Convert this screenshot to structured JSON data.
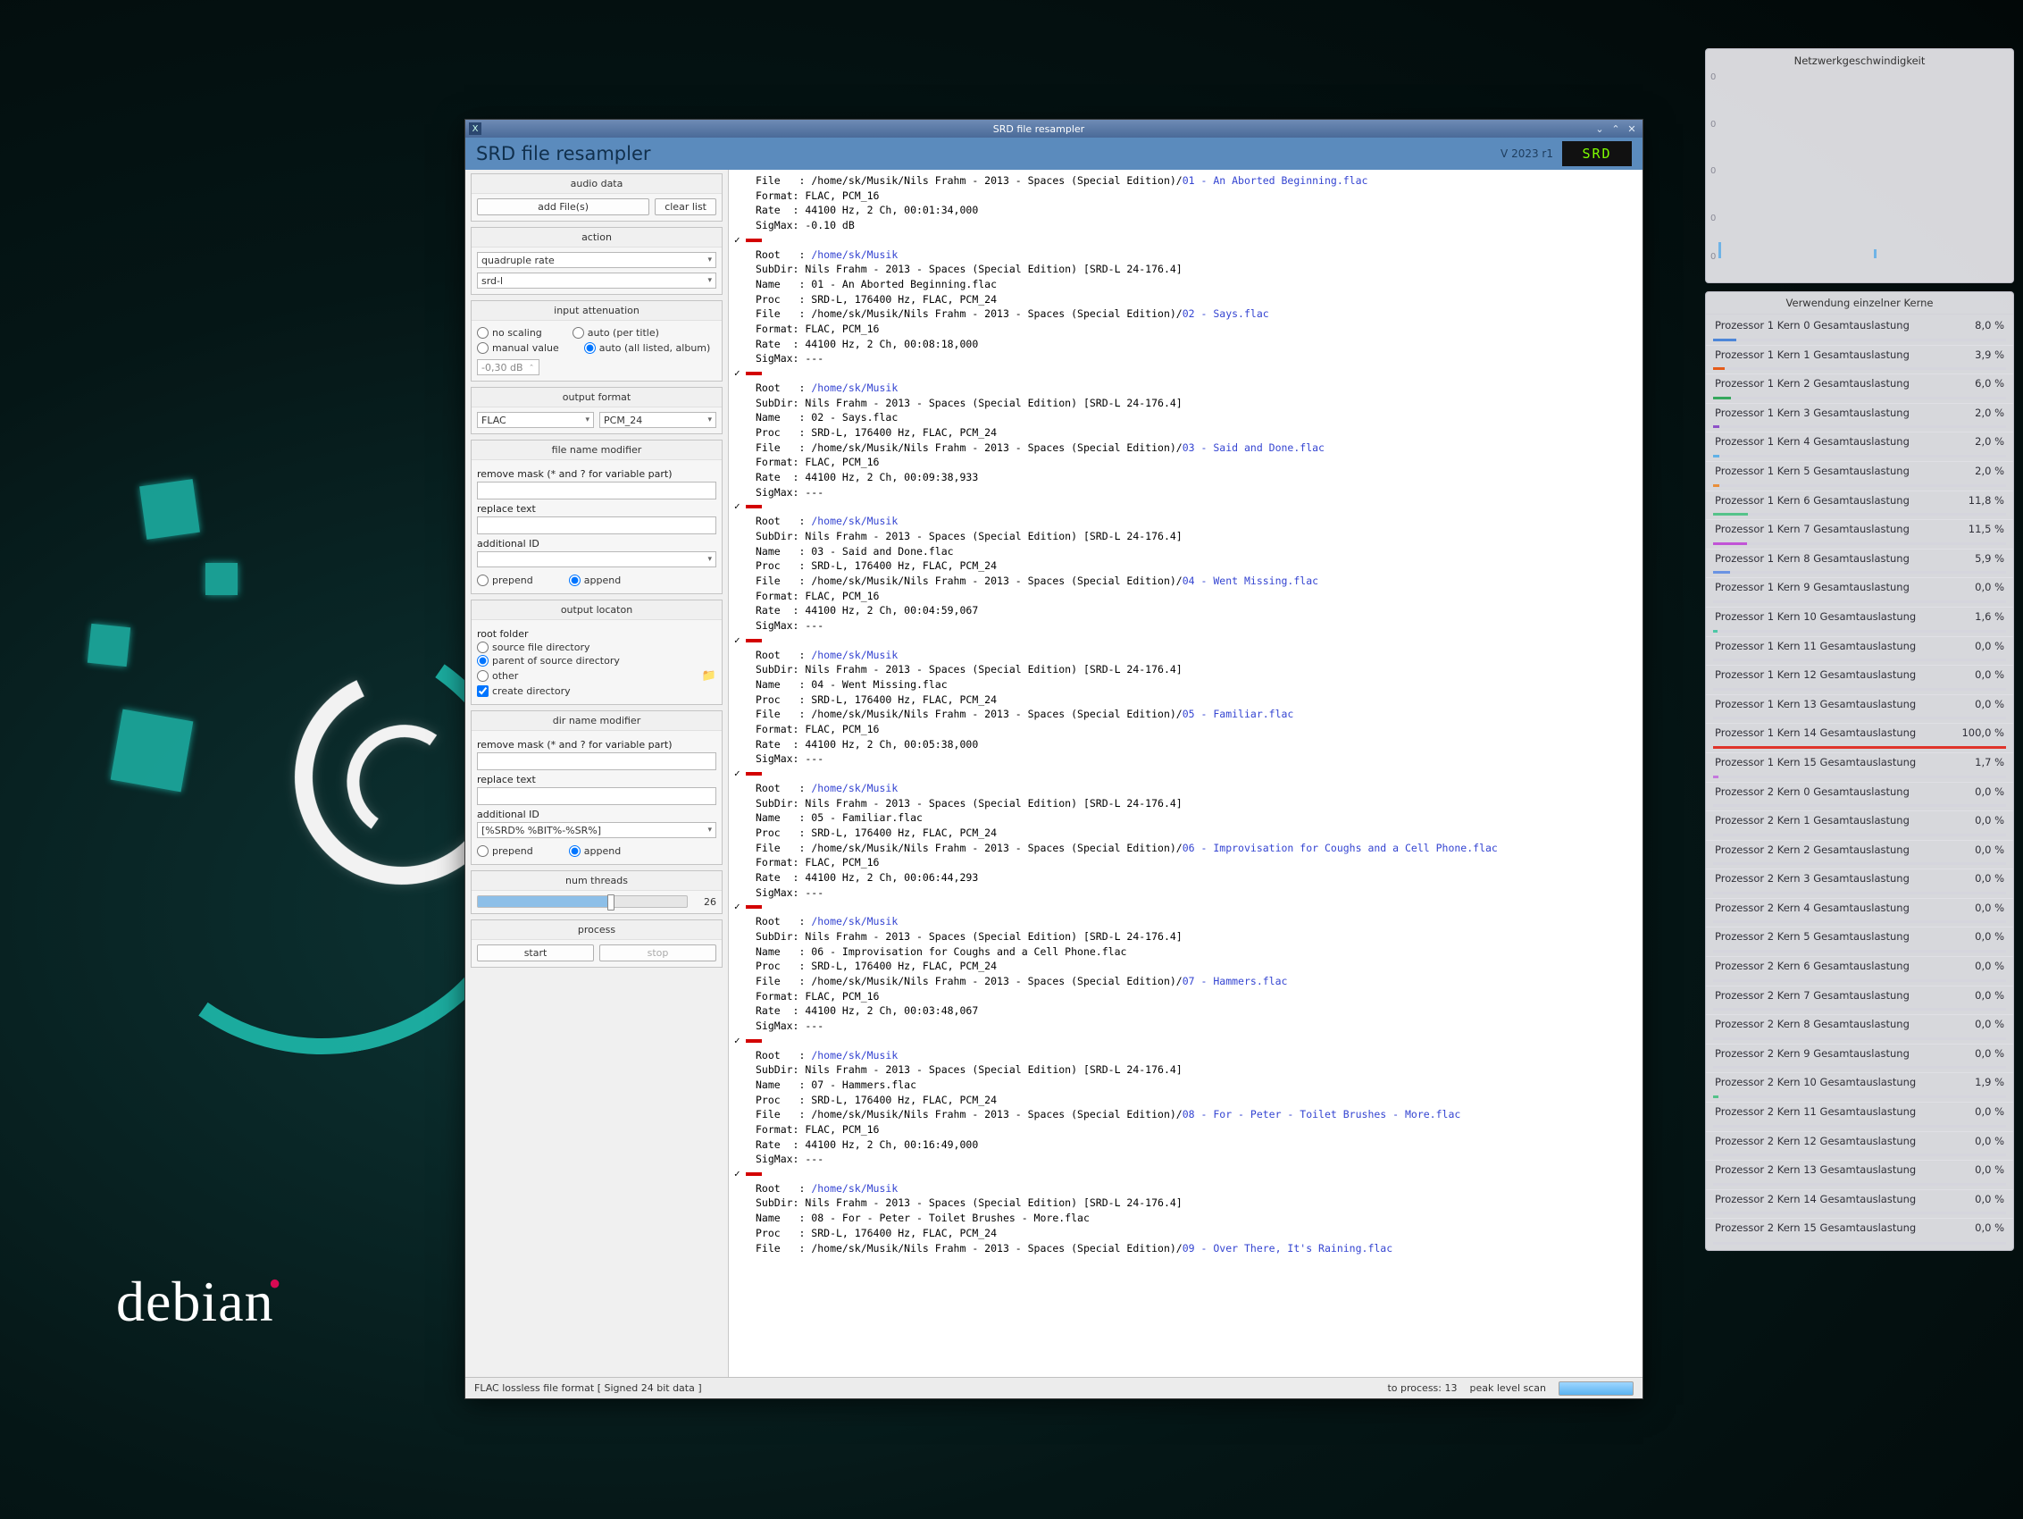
{
  "wallpaper": {
    "os_label": "debian"
  },
  "app": {
    "window_title": "SRD file resampler",
    "header_title": "SRD file resampler",
    "version": "V 2023 r1",
    "logo_text": "SRD",
    "panels": {
      "audio_data": {
        "title": "audio data",
        "add_btn": "add File(s)",
        "clear_btn": "clear list"
      },
      "action": {
        "title": "action",
        "mode": "quadruple rate",
        "engine": "srd-l"
      },
      "input_attenuation": {
        "title": "input attenuation",
        "opt_none": "no scaling",
        "opt_auto_title": "auto (per title)",
        "opt_manual": "manual value",
        "opt_auto_all": "auto (all listed, album)",
        "spin_value": "-0,30 dB"
      },
      "output_format": {
        "title": "output format",
        "container": "FLAC",
        "encoding": "PCM_24"
      },
      "file_name_modifier": {
        "title": "file name modifier",
        "remove_mask": "remove mask (* and ? for variable part)",
        "replace_text": "replace text",
        "additional_id": "additional ID",
        "prepend": "prepend",
        "append": "append"
      },
      "output_location": {
        "title": "output locaton",
        "root_folder": "root folder",
        "opt_source": "source file directory",
        "opt_parent": "parent of source directory",
        "opt_other": "other",
        "chk_create": "create directory"
      },
      "dir_name_modifier": {
        "title": "dir name modifier",
        "remove_mask": "remove mask (* and ? for variable part)",
        "replace_text": "replace text",
        "additional_id": "additional ID",
        "id_value": "[%SRD% %BIT%-%SR%]",
        "prepend": "prepend",
        "append": "append"
      },
      "num_threads": {
        "title": "num threads",
        "value": "26"
      },
      "process": {
        "title": "process",
        "start": "start",
        "stop": "stop"
      }
    },
    "log": {
      "root_path": "/home/sk/Musik",
      "subdir": "Nils Frahm - 2013 - Spaces (Special Edition) [SRD-L 24-176.4]",
      "proc": "SRD-L, 176400 Hz, FLAC, PCM_24",
      "format": "FLAC, PCM_16",
      "sigmax_unknown": "---",
      "labels": {
        "file": "File   : ",
        "format": "Format: ",
        "rate": "Rate  : ",
        "sigmax": "SigMax: ",
        "root": "Root   : ",
        "subdir": "SubDir: ",
        "name": "Name   : ",
        "proc": "Proc   : "
      },
      "entries": [
        {
          "n": "01",
          "title": "An Aborted Beginning",
          "rate": "44100 Hz, 2 Ch, 00:01:34,000",
          "sigmax": "-0.10 dB"
        },
        {
          "n": "02",
          "title": "Says",
          "rate": "44100 Hz, 2 Ch, 00:08:18,000"
        },
        {
          "n": "03",
          "title": "Said and Done",
          "rate": "44100 Hz, 2 Ch, 00:09:38,933"
        },
        {
          "n": "04",
          "title": "Went Missing",
          "rate": "44100 Hz, 2 Ch, 00:04:59,067"
        },
        {
          "n": "05",
          "title": "Familiar",
          "rate": "44100 Hz, 2 Ch, 00:05:38,000"
        },
        {
          "n": "06",
          "title": "Improvisation for Coughs and a Cell Phone",
          "rate": "44100 Hz, 2 Ch, 00:06:44,293"
        },
        {
          "n": "07",
          "title": "Hammers",
          "rate": "44100 Hz, 2 Ch, 00:03:48,067"
        },
        {
          "n": "08",
          "title": "For - Peter - Toilet Brushes - More",
          "rate": "44100 Hz, 2 Ch, 00:16:49,000"
        },
        {
          "n": "09",
          "title": "Over There, It's Raining",
          "partial": true
        }
      ],
      "src_prefix": "/home/sk/Musik/Nils Frahm - 2013 - Spaces (Special Edition)/"
    },
    "status": {
      "format_info": "FLAC lossless file format [ Signed 24 bit data ]",
      "to_process": "to process: 13",
      "peak_scan": "peak level scan"
    }
  },
  "net_widget": {
    "title": "Netzwerkgeschwindigkeit",
    "y_ticks": [
      "0",
      "0",
      "0",
      "0",
      "0"
    ]
  },
  "core_widget": {
    "title": "Verwendung einzelner Kerne",
    "rows": [
      {
        "label": "Prozessor 1 Kern 0 Gesamtauslastung",
        "pct": "8,0 %",
        "w": 8,
        "c": "#4d86d8"
      },
      {
        "label": "Prozessor 1 Kern 1 Gesamtauslastung",
        "pct": "3,9 %",
        "w": 3.9,
        "c": "#e55b1a"
      },
      {
        "label": "Prozessor 1 Kern 2 Gesamtauslastung",
        "pct": "6,0 %",
        "w": 6,
        "c": "#36a85d"
      },
      {
        "label": "Prozessor 1 Kern 3 Gesamtauslastung",
        "pct": "2,0 %",
        "w": 2,
        "c": "#8e51c8"
      },
      {
        "label": "Prozessor 1 Kern 4 Gesamtauslastung",
        "pct": "2,0 %",
        "w": 2,
        "c": "#60b1e6"
      },
      {
        "label": "Prozessor 1 Kern 5 Gesamtauslastung",
        "pct": "2,0 %",
        "w": 2,
        "c": "#e98f39"
      },
      {
        "label": "Prozessor 1 Kern 6 Gesamtauslastung",
        "pct": "11,8 %",
        "w": 11.8,
        "c": "#55c38a"
      },
      {
        "label": "Prozessor 1 Kern 7 Gesamtauslastung",
        "pct": "11,5 %",
        "w": 11.5,
        "c": "#c154d6"
      },
      {
        "label": "Prozessor 1 Kern 8 Gesamtauslastung",
        "pct": "5,9 %",
        "w": 5.9,
        "c": "#6a93e3"
      },
      {
        "label": "Prozessor 1 Kern 9 Gesamtauslastung",
        "pct": "0,0 %",
        "w": 0,
        "c": "#eea24b"
      },
      {
        "label": "Prozessor 1 Kern 10 Gesamtauslastung",
        "pct": "1,6 %",
        "w": 1.6,
        "c": "#4dc7a6"
      },
      {
        "label": "Prozessor 1 Kern 11 Gesamtauslastung",
        "pct": "0,0 %",
        "w": 0,
        "c": "#c572e0"
      },
      {
        "label": "Prozessor 1 Kern 12 Gesamtauslastung",
        "pct": "0,0 %",
        "w": 0,
        "c": "#639ae6"
      },
      {
        "label": "Prozessor 1 Kern 13 Gesamtauslastung",
        "pct": "0,0 %",
        "w": 0,
        "c": "#e77a33"
      },
      {
        "label": "Prozessor 1 Kern 14 Gesamtauslastung",
        "pct": "100,0 %",
        "w": 100,
        "c": "#e0342a"
      },
      {
        "label": "Prozessor 1 Kern 15 Gesamtauslastung",
        "pct": "1,7 %",
        "w": 1.7,
        "c": "#c478dd"
      },
      {
        "label": "Prozessor 2 Kern 0 Gesamtauslastung",
        "pct": "0,0 %",
        "w": 0,
        "c": "#5a9fe2"
      },
      {
        "label": "Prozessor 2 Kern 1 Gesamtauslastung",
        "pct": "0,0 %",
        "w": 0,
        "c": "#e88d43"
      },
      {
        "label": "Prozessor 2 Kern 2 Gesamtauslastung",
        "pct": "0,0 %",
        "w": 0,
        "c": "#59c591"
      },
      {
        "label": "Prozessor 2 Kern 3 Gesamtauslastung",
        "pct": "0,0 %",
        "w": 0,
        "c": "#c872de"
      },
      {
        "label": "Prozessor 2 Kern 4 Gesamtauslastung",
        "pct": "0,0 %",
        "w": 0,
        "c": "#6097df"
      },
      {
        "label": "Prozessor 2 Kern 5 Gesamtauslastung",
        "pct": "0,0 %",
        "w": 0,
        "c": "#e98b44"
      },
      {
        "label": "Prozessor 2 Kern 6 Gesamtauslastung",
        "pct": "0,0 %",
        "w": 0,
        "c": "#55c38a"
      },
      {
        "label": "Prozessor 2 Kern 7 Gesamtauslastung",
        "pct": "0,0 %",
        "w": 0,
        "c": "#c674dc"
      },
      {
        "label": "Prozessor 2 Kern 8 Gesamtauslastung",
        "pct": "0,0 %",
        "w": 0,
        "c": "#6096de"
      },
      {
        "label": "Prozessor 2 Kern 9 Gesamtauslastung",
        "pct": "0,0 %",
        "w": 0,
        "c": "#e88b44"
      },
      {
        "label": "Prozessor 2 Kern 10 Gesamtauslastung",
        "pct": "1,9 %",
        "w": 1.9,
        "c": "#54c289"
      },
      {
        "label": "Prozessor 2 Kern 11 Gesamtauslastung",
        "pct": "0,0 %",
        "w": 0,
        "c": "#c674dc"
      },
      {
        "label": "Prozessor 2 Kern 12 Gesamtauslastung",
        "pct": "0,0 %",
        "w": 0,
        "c": "#6096de"
      },
      {
        "label": "Prozessor 2 Kern 13 Gesamtauslastung",
        "pct": "0,0 %",
        "w": 0,
        "c": "#e88b44"
      },
      {
        "label": "Prozessor 2 Kern 14 Gesamtauslastung",
        "pct": "0,0 %",
        "w": 0,
        "c": "#54c289"
      },
      {
        "label": "Prozessor 2 Kern 15 Gesamtauslastung",
        "pct": "0,0 %",
        "w": 0,
        "c": "#c674dc"
      }
    ]
  }
}
